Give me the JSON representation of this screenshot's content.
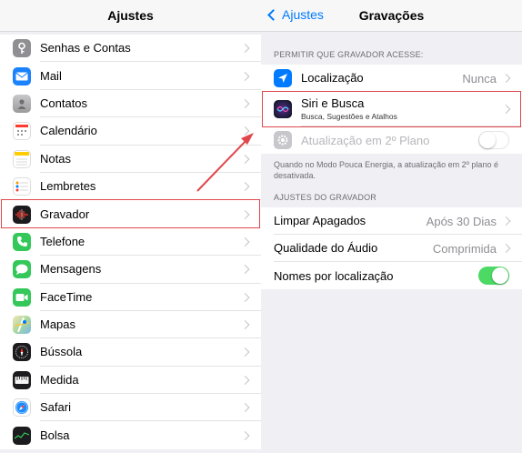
{
  "left": {
    "title": "Ajustes",
    "items": [
      {
        "label": "Senhas e Contas",
        "icon": "key-icon",
        "color": "#8e8e93"
      },
      {
        "label": "Mail",
        "icon": "mail-icon",
        "color": "#1a82fb"
      },
      {
        "label": "Contatos",
        "icon": "contacts-icon",
        "color": "#9b9b9b"
      },
      {
        "label": "Calendário",
        "icon": "calendar-icon",
        "color": "#ffffff"
      },
      {
        "label": "Notas",
        "icon": "notes-icon",
        "color": "#ffffff"
      },
      {
        "label": "Lembretes",
        "icon": "reminders-icon",
        "color": "#ffffff"
      },
      {
        "label": "Gravador",
        "icon": "voice-memos-icon",
        "color": "#1c1c1e"
      },
      {
        "label": "Telefone",
        "icon": "phone-icon",
        "color": "#34c759"
      },
      {
        "label": "Mensagens",
        "icon": "messages-icon",
        "color": "#34c759"
      },
      {
        "label": "FaceTime",
        "icon": "facetime-icon",
        "color": "#34c759"
      },
      {
        "label": "Mapas",
        "icon": "maps-icon",
        "color": "#6fc48f"
      },
      {
        "label": "Bússola",
        "icon": "compass-icon",
        "color": "#1c1c1e"
      },
      {
        "label": "Medida",
        "icon": "measure-icon",
        "color": "#1c1c1e"
      },
      {
        "label": "Safari",
        "icon": "safari-icon",
        "color": "#ffffff"
      },
      {
        "label": "Bolsa",
        "icon": "stocks-icon",
        "color": "#1c1c1e"
      }
    ]
  },
  "right": {
    "back_label": "Ajustes",
    "title": "Gravações",
    "section1_header": "PERMITIR QUE GRAVADOR ACESSE:",
    "location": {
      "label": "Localização",
      "value": "Nunca"
    },
    "siri": {
      "label": "Siri e Busca",
      "sublabel": "Busca, Sugestões e Atalhos"
    },
    "bg_refresh": {
      "label": "Atualização em 2º Plano",
      "enabled": false
    },
    "low_power_note": "Quando no Modo Pouca Energia, a atualização em 2º plano é desativada.",
    "section2_header": "AJUSTES DO GRAVADOR",
    "clear_deleted": {
      "label": "Limpar Apagados",
      "value": "Após 30 Dias"
    },
    "audio_quality": {
      "label": "Qualidade do Áudio",
      "value": "Comprimida"
    },
    "location_names": {
      "label": "Nomes por localização",
      "enabled": true
    }
  },
  "colors": {
    "accent": "#007aff",
    "highlight": "#e0474c",
    "toggle_on": "#4cd964"
  }
}
